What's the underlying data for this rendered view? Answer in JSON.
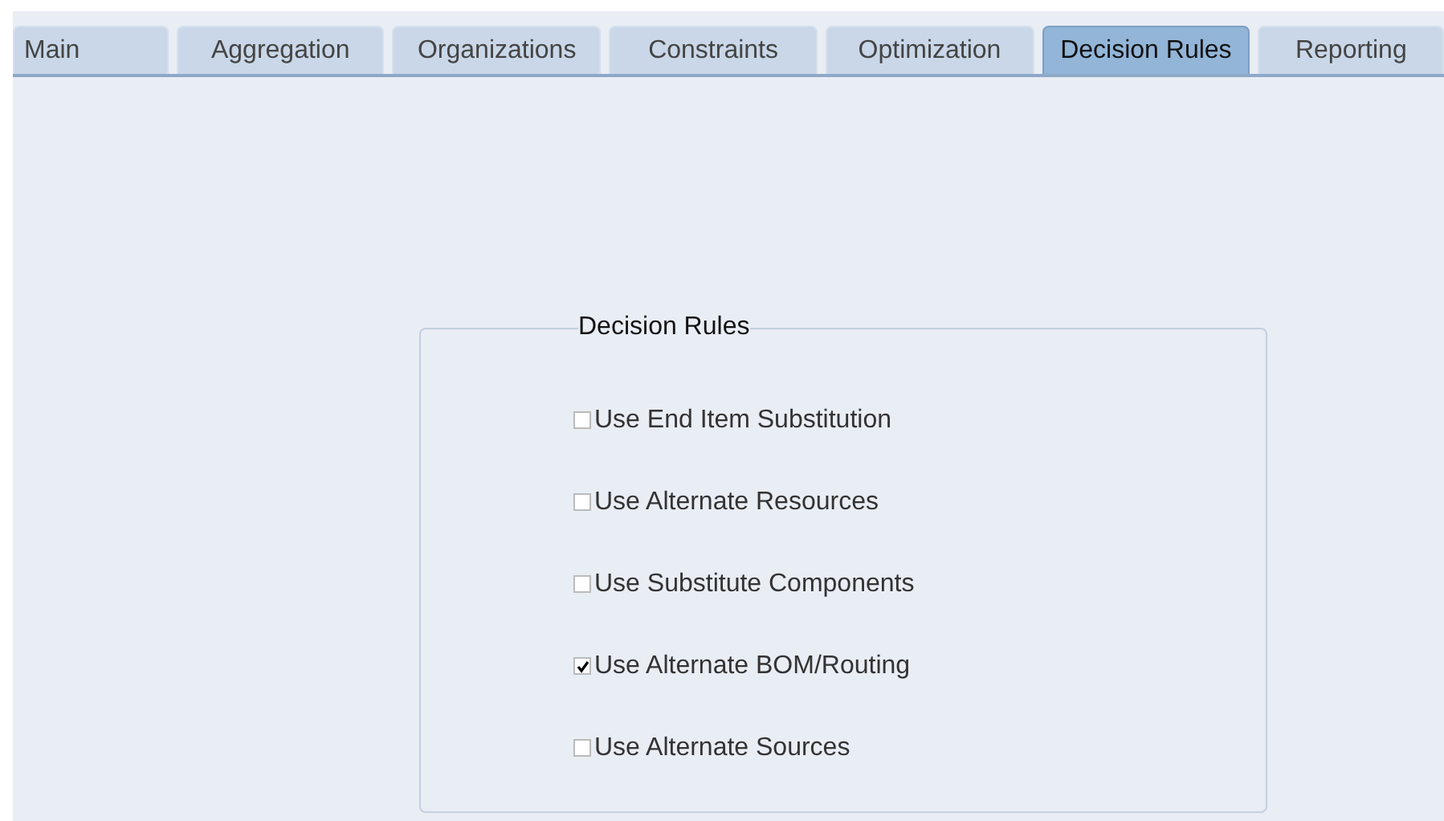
{
  "tabs": [
    {
      "label": "Main",
      "selected": false
    },
    {
      "label": "Aggregation",
      "selected": false
    },
    {
      "label": "Organizations",
      "selected": false
    },
    {
      "label": "Constraints",
      "selected": false
    },
    {
      "label": "Optimization",
      "selected": false
    },
    {
      "label": "Decision Rules",
      "selected": true
    },
    {
      "label": "Reporting",
      "selected": false
    }
  ],
  "group": {
    "title": "Decision Rules",
    "options": [
      {
        "label": "Use End Item Substitution",
        "checked": false
      },
      {
        "label": "Use Alternate Resources",
        "checked": false
      },
      {
        "label": "Use Substitute Components",
        "checked": false
      },
      {
        "label": "Use Alternate BOM/Routing",
        "checked": true
      },
      {
        "label": "Use Alternate Sources",
        "checked": false
      }
    ]
  }
}
